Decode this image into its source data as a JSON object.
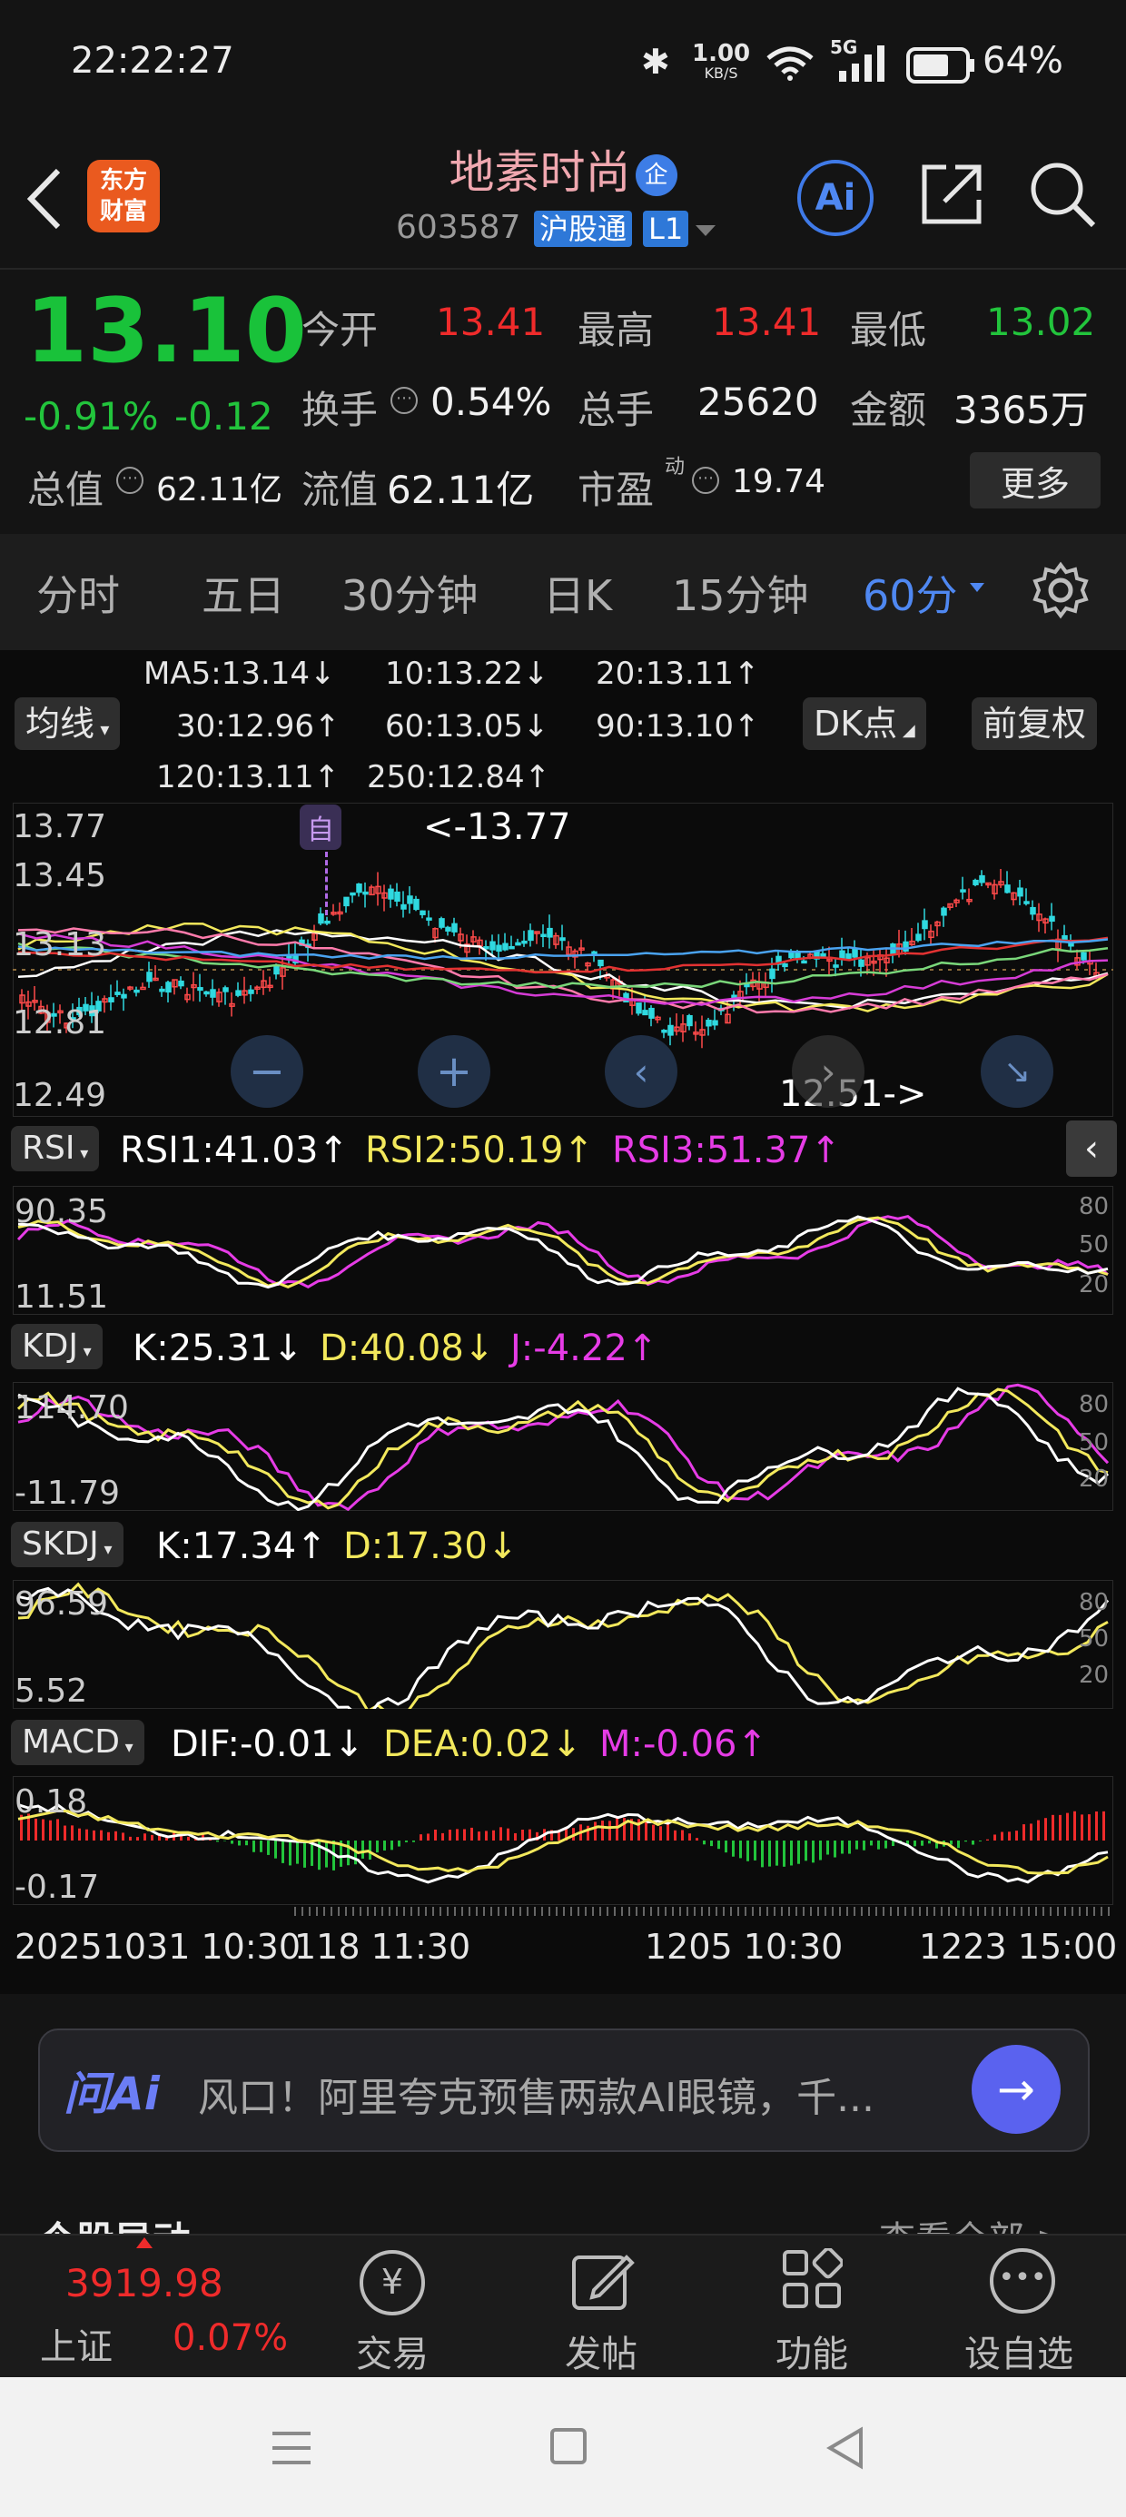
{
  "status_bar": {
    "time": "22:22:27",
    "net_speed_value": "1.00",
    "net_speed_unit": "KB/S",
    "battery": "64%",
    "signal": "5G"
  },
  "header": {
    "app_logo_line1": "东方",
    "app_logo_line2": "财富",
    "stock_name": "地素时尚",
    "name_badge": "企",
    "stock_code": "603587",
    "tag_market": "沪股通",
    "tag_level": "L1",
    "ai_label": "Ai"
  },
  "quote": {
    "price": "13.10",
    "change_pct": "-0.91%",
    "change_amt": "-0.12",
    "open_label": "今开",
    "open_value": "13.41",
    "high_label": "最高",
    "high_value": "13.41",
    "low_label": "最低",
    "low_value": "13.02",
    "turnover_label": "换手",
    "turnover_value": "0.54%",
    "volume_label": "总手",
    "volume_value": "25620",
    "amount_label": "金额",
    "amount_value": "3365万",
    "total_mv_label": "总值",
    "total_mv_value": "62.11亿",
    "float_mv_label": "流值",
    "float_mv_value": "62.11亿",
    "pe_label": "市盈",
    "pe_sup": "动",
    "pe_value": "19.74",
    "more_button": "更多"
  },
  "period_tabs": [
    "分时",
    "五日",
    "30分钟",
    "日K",
    "15分钟",
    "60分"
  ],
  "active_period": "60分",
  "chart_controls": {
    "ma_selector": "均线",
    "dk_button": "DK点",
    "rights_button": "前复权"
  },
  "ma_legend": [
    {
      "label": "MA5:13.14↓",
      "color": "#ffffff"
    },
    {
      "label": "10:13.22↓",
      "color": "#f2e85c"
    },
    {
      "label": "20:13.11↑",
      "color": "#ff7bac"
    },
    {
      "label": "30:12.96↑",
      "color": "#d63cd6"
    },
    {
      "label": "60:13.05↓",
      "color": "#7ad77a"
    },
    {
      "label": "90:13.10↑",
      "color": "#e33232"
    },
    {
      "label": "120:13.11↑",
      "color": "#4aa3f0"
    },
    {
      "label": "250:12.84↑",
      "color": "#4aa3f0"
    }
  ],
  "kline": {
    "y_ticks": [
      "13.77",
      "13.45",
      "13.13",
      "12.81",
      "12.49"
    ],
    "high_marker": "<-13.77",
    "low_marker": "12.51->",
    "self_marker": "自"
  },
  "rsi": {
    "name": "RSI",
    "values": [
      "RSI1:41.03↑",
      "RSI2:50.19↑",
      "RSI3:51.37↑"
    ],
    "y_max": "90.35",
    "y_min": "11.51",
    "levels": [
      "80",
      "50",
      "20"
    ]
  },
  "kdj": {
    "name": "KDJ",
    "values": [
      "K:25.31↓",
      "D:40.08↓",
      "J:-4.22↑"
    ],
    "y_max": "114.70",
    "y_min": "-11.79",
    "levels": [
      "80",
      "50",
      "20"
    ]
  },
  "skdj": {
    "name": "SKDJ",
    "values": [
      "K:17.34↑",
      "D:17.30↓"
    ],
    "y_max": "96.59",
    "y_min": "5.52",
    "levels": [
      "80",
      "50",
      "20"
    ]
  },
  "macd": {
    "name": "MACD",
    "values": [
      "DIF:-0.01↓",
      "DEA:0.02↓",
      "M:-0.06↑"
    ],
    "y_max": "0.18",
    "y_min": "-0.17"
  },
  "x_axis": [
    "20251031 10:30",
    "118 11:30",
    "1205 10:30",
    "1223 15:00"
  ],
  "ai_bar": {
    "label": "问Ai",
    "prompt": "风口！阿里夸克预售两款AI眼镜，千..."
  },
  "partial_section": {
    "title": "个股异动",
    "link": "查看全部 >"
  },
  "bottom_nav": {
    "index_value": "3919.98",
    "index_name": "上证",
    "index_change": "0.07%",
    "items": [
      "交易",
      "发帖",
      "功能",
      "设自选"
    ]
  },
  "colors": {
    "up": "#ef2b2b",
    "down": "#22c43c",
    "accent": "#4a7cf0",
    "background": "#141414"
  }
}
